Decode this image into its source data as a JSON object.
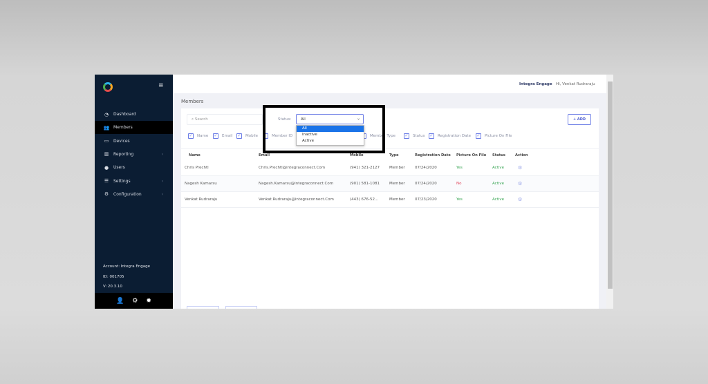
{
  "sidebar": {
    "items": [
      {
        "label": "Dashboard",
        "icon": "dashboard-icon"
      },
      {
        "label": "Members",
        "icon": "members-icon",
        "active": true
      },
      {
        "label": "Devices",
        "icon": "tablet-icon"
      },
      {
        "label": "Reporting",
        "icon": "chart-icon",
        "chevron": true
      },
      {
        "label": "Users",
        "icon": "user-icon"
      },
      {
        "label": "Settings",
        "icon": "sliders-icon",
        "chevron": true
      },
      {
        "label": "Configuration",
        "icon": "gear-icon",
        "chevron": true
      }
    ],
    "account": "Account: Integra Engage",
    "id": "ID: 001705",
    "version": "V: 20.3.10"
  },
  "header": {
    "brand": "Integra Engage",
    "greeting": "Hi,  Venkat Rudraraju"
  },
  "page": {
    "title": "Members"
  },
  "toolbar": {
    "search_placeholder": "Search",
    "status_label": "Status:",
    "status_value": "All",
    "status_options": [
      "All",
      "Inactive",
      "Active"
    ],
    "add_label": "ADD"
  },
  "columns_toggle": [
    {
      "label": "Name",
      "checked": true
    },
    {
      "label": "Email",
      "checked": true
    },
    {
      "label": "Mobile",
      "checked": true
    },
    {
      "label": "Member ID",
      "checked": false
    },
    {
      "label": "Member Type",
      "checked": true
    },
    {
      "label": "Status",
      "checked": true
    },
    {
      "label": "Registration Date",
      "checked": true
    },
    {
      "label": "Picture On File",
      "checked": true
    }
  ],
  "table": {
    "headers": [
      "Name",
      "Email",
      "Mobile",
      "Type",
      "Registration Date",
      "Picture On File",
      "Status",
      "Action"
    ],
    "rows": [
      {
        "name": "Chris Prechtl",
        "email": "Chris.Prechtl@integraconnect.Com",
        "mobile": "(941) 321-2127",
        "type": "Member",
        "date": "07/24/2020",
        "picture": "Yes",
        "status": "Active"
      },
      {
        "name": "Nagesh Kamarsu",
        "email": "Nagesh.Kamarsu@integraconnect.Com",
        "mobile": "(901) 581-1081",
        "type": "Member",
        "date": "07/24/2020",
        "picture": "No",
        "status": "Active"
      },
      {
        "name": "Venkat Rudraraju",
        "email": "Venkat.Rudraraju@integraconnect.Com",
        "mobile": "(443) 676-52...",
        "type": "Member",
        "date": "07/23/2020",
        "picture": "Yes",
        "status": "Active"
      }
    ]
  },
  "colors": {
    "sidebar": "#0b1d33",
    "accent": "#6d7ee6",
    "yes": "#3aa655",
    "no": "#e0445a",
    "highlight": "#1a73e8"
  }
}
